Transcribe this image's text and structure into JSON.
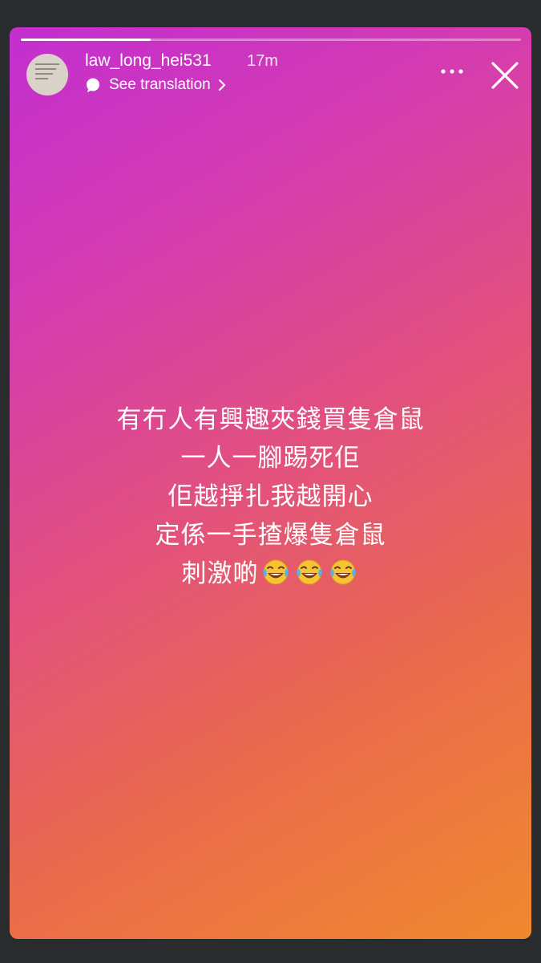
{
  "story": {
    "progress": 0.26,
    "username": "law_long_hei531",
    "time_ago": "17m",
    "see_translation": "See translation",
    "message_lines": [
      "有冇人有興趣夾錢買隻倉鼠",
      "一人一腳踢死佢",
      "佢越掙扎我越開心",
      "定係一手揸爆隻倉鼠",
      "刺激啲"
    ],
    "trailing_emoji": [
      "face-with-tears-of-joy",
      "face-with-tears-of-joy",
      "face-with-tears-of-joy"
    ]
  },
  "icons": {
    "translate": "translate-bubble-icon",
    "chevron": "chevron-right-icon",
    "more": "more-horizontal-icon",
    "close": "close-icon"
  },
  "colors": {
    "gradient_start": "#c22fd0",
    "gradient_end": "#f0892e",
    "frame": "#2a2b2d"
  }
}
